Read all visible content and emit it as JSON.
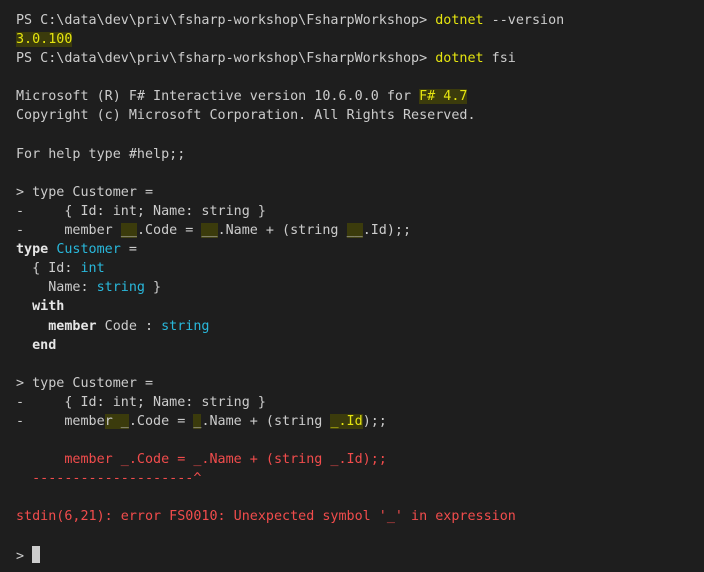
{
  "prompt1": {
    "ps": "PS C:\\data\\dev\\priv\\fsharp-workshop\\FsharpWorkshop> ",
    "cmd": "dotnet",
    "args": " --version"
  },
  "version_output": "3.0.100",
  "prompt2": {
    "ps": "PS C:\\data\\dev\\priv\\fsharp-workshop\\FsharpWorkshop> ",
    "cmd": "dotnet",
    "args": " fsi"
  },
  "banner": {
    "line1_pre": "Microsoft (R) F# Interactive version 10.6.0.0 for ",
    "line1_fsharp": "F# 4.7",
    "line2": "Copyright (c) Microsoft Corporation. All Rights Reserved.",
    "help": "For help type #help;;"
  },
  "input1": {
    "l1": "> type Customer =",
    "l2": "-     { Id: int; Name: string }",
    "l3_a": "-     member ",
    "l3_b": "__",
    "l3_c": ".Code = ",
    "l3_d": "__",
    "l3_e": ".Name + (string ",
    "l3_f": "__",
    "l3_g": ".Id);;"
  },
  "output1": {
    "type_kw": "type",
    "type_name": "Customer",
    "eq": " =",
    "brace_open": "  { Id: ",
    "int_t": "int",
    "name_pre": "    Name: ",
    "string_t": "string",
    "brace_close": " }",
    "with_kw": "  with",
    "member_kw": "member",
    "member_pre": "    ",
    "member_rest": " Code : ",
    "string_t2": "string",
    "end_kw": "  end"
  },
  "input2": {
    "l1": "> type Customer =",
    "l2": "-     { Id: int; Name: string }",
    "l3_a": "-     membe",
    "l3_b": "r _",
    "l3_c": ".Code = ",
    "l3_d": "_",
    "l3_e": ".Name + (string ",
    "l3_f": "_.Id",
    "l3_g": ");;"
  },
  "error": {
    "echo": "      member _.Code = _.Name + (string _.Id);;",
    "caret": "  --------------------^",
    "message": "stdin(6,21): error FS0010: Unexpected symbol '_' in expression"
  },
  "final_prompt": ">"
}
